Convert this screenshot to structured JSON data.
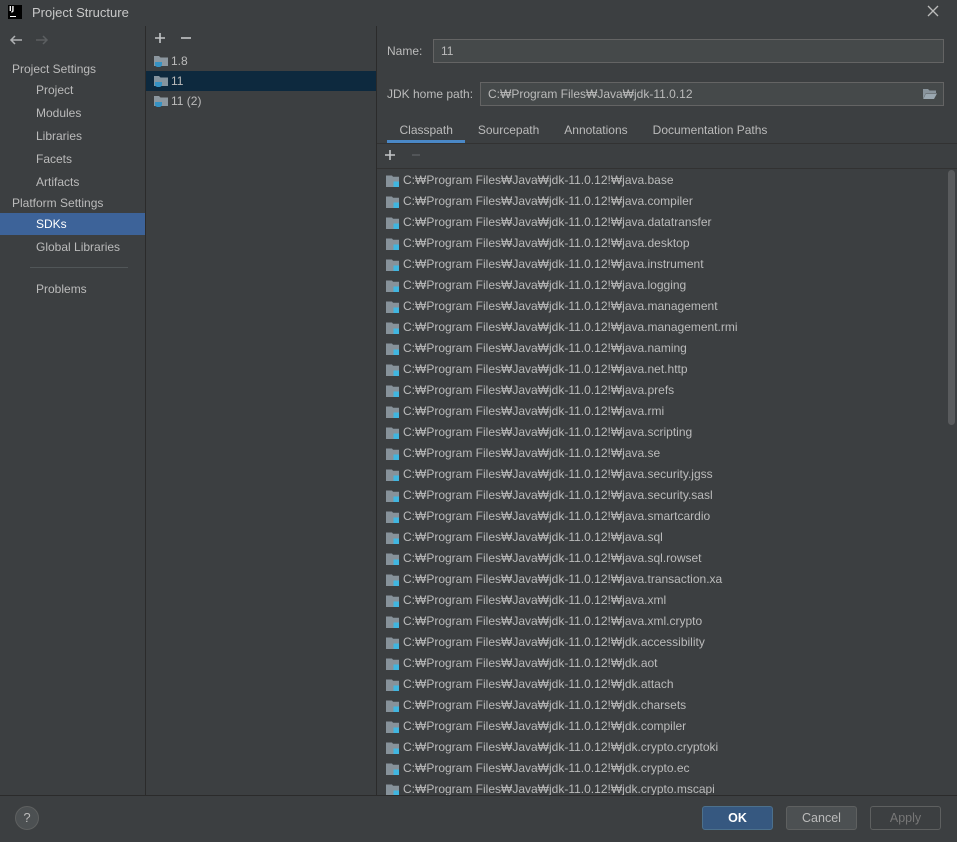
{
  "window": {
    "title": "Project Structure",
    "app_icon_text": "IJ"
  },
  "nav": {
    "project_settings_header": "Project Settings",
    "project_items": [
      "Project",
      "Modules",
      "Libraries",
      "Facets",
      "Artifacts"
    ],
    "platform_settings_header": "Platform Settings",
    "platform_items": [
      "SDKs",
      "Global Libraries"
    ],
    "problems": "Problems",
    "selected": "SDKs"
  },
  "sdk_list": {
    "items": [
      "1.8",
      "11",
      "11 (2)"
    ],
    "selected": "11"
  },
  "sdk_details": {
    "name_label": "Name:",
    "name_value": "11",
    "home_path_label": "JDK home path:",
    "home_path_value": "C:₩Program Files₩Java₩jdk-11.0.12",
    "tabs": [
      "Classpath",
      "Sourcepath",
      "Annotations",
      "Documentation Paths"
    ],
    "active_tab": "Classpath",
    "classpath": [
      "C:₩Program Files₩Java₩jdk-11.0.12!₩java.base",
      "C:₩Program Files₩Java₩jdk-11.0.12!₩java.compiler",
      "C:₩Program Files₩Java₩jdk-11.0.12!₩java.datatransfer",
      "C:₩Program Files₩Java₩jdk-11.0.12!₩java.desktop",
      "C:₩Program Files₩Java₩jdk-11.0.12!₩java.instrument",
      "C:₩Program Files₩Java₩jdk-11.0.12!₩java.logging",
      "C:₩Program Files₩Java₩jdk-11.0.12!₩java.management",
      "C:₩Program Files₩Java₩jdk-11.0.12!₩java.management.rmi",
      "C:₩Program Files₩Java₩jdk-11.0.12!₩java.naming",
      "C:₩Program Files₩Java₩jdk-11.0.12!₩java.net.http",
      "C:₩Program Files₩Java₩jdk-11.0.12!₩java.prefs",
      "C:₩Program Files₩Java₩jdk-11.0.12!₩java.rmi",
      "C:₩Program Files₩Java₩jdk-11.0.12!₩java.scripting",
      "C:₩Program Files₩Java₩jdk-11.0.12!₩java.se",
      "C:₩Program Files₩Java₩jdk-11.0.12!₩java.security.jgss",
      "C:₩Program Files₩Java₩jdk-11.0.12!₩java.security.sasl",
      "C:₩Program Files₩Java₩jdk-11.0.12!₩java.smartcardio",
      "C:₩Program Files₩Java₩jdk-11.0.12!₩java.sql",
      "C:₩Program Files₩Java₩jdk-11.0.12!₩java.sql.rowset",
      "C:₩Program Files₩Java₩jdk-11.0.12!₩java.transaction.xa",
      "C:₩Program Files₩Java₩jdk-11.0.12!₩java.xml",
      "C:₩Program Files₩Java₩jdk-11.0.12!₩java.xml.crypto",
      "C:₩Program Files₩Java₩jdk-11.0.12!₩jdk.accessibility",
      "C:₩Program Files₩Java₩jdk-11.0.12!₩jdk.aot",
      "C:₩Program Files₩Java₩jdk-11.0.12!₩jdk.attach",
      "C:₩Program Files₩Java₩jdk-11.0.12!₩jdk.charsets",
      "C:₩Program Files₩Java₩jdk-11.0.12!₩jdk.compiler",
      "C:₩Program Files₩Java₩jdk-11.0.12!₩jdk.crypto.cryptoki",
      "C:₩Program Files₩Java₩jdk-11.0.12!₩jdk.crypto.ec",
      "C:₩Program Files₩Java₩jdk-11.0.12!₩jdk.crypto.mscapi"
    ]
  },
  "footer": {
    "help": "?",
    "ok": "OK",
    "cancel": "Cancel",
    "apply": "Apply",
    "apply_disabled": true
  },
  "icons": {
    "app": "intellij-icon",
    "close": "close-icon",
    "back": "arrow-left-icon",
    "forward": "arrow-right-icon",
    "add": "plus-icon",
    "remove": "minus-icon",
    "sdk": "sdk-folder-icon",
    "browse": "folder-open-icon",
    "classpath_entry": "jar-icon",
    "help": "help-icon"
  },
  "colors": {
    "background": "#3c3f41",
    "text": "#bbbbbb",
    "nav_selection": "#3d6399",
    "list_selection_unfocused": "#0d293e",
    "input_background": "#45494a",
    "input_border": "#646464",
    "default_button": "#365880",
    "tab_underline": "#4a88c7",
    "library_badge": "#40b6e0"
  }
}
